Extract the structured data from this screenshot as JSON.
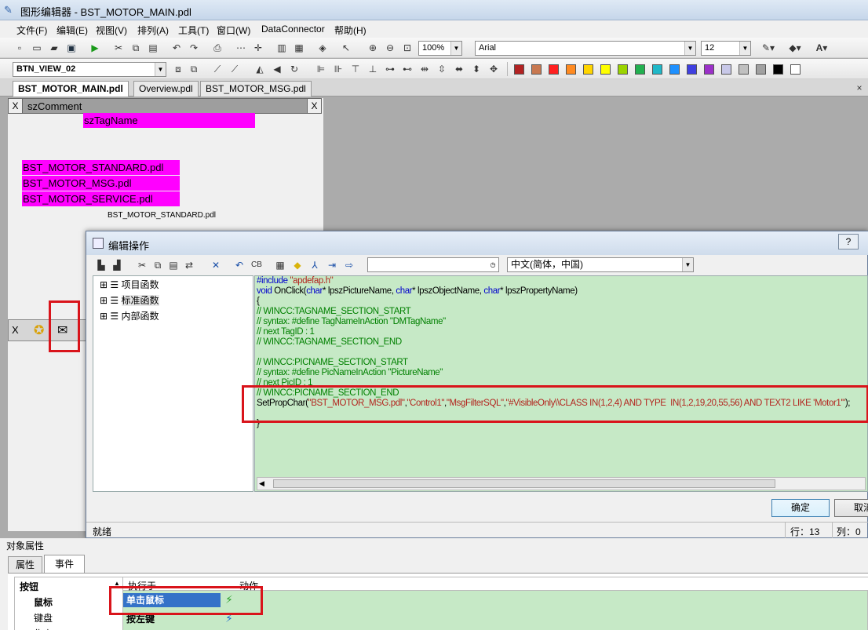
{
  "window": {
    "title": "图形编辑器 - BST_MOTOR_MAIN.pdl"
  },
  "menu": [
    "文件(F)",
    "编辑(E)",
    "视图(V)",
    "排列(A)",
    "工具(T)",
    "窗口(W)",
    "DataConnector",
    "帮助(H)"
  ],
  "toolbar1": {
    "zoom": "100%",
    "font": "Arial",
    "size": "12"
  },
  "toolbar2": {
    "object": "BTN_VIEW_02"
  },
  "palette": [
    "#b22222",
    "#c87850",
    "#ff2020",
    "#ff8a20",
    "#ffd500",
    "#ffff00",
    "#9bd400",
    "#22b050",
    "#20b8c8",
    "#1e90ff",
    "#4040e0",
    "#9b30c8",
    "#c8c8e8",
    "#c0c0c0",
    "#a0a0a0",
    "#000000",
    "#ffffff"
  ],
  "tabs": [
    "BST_MOTOR_MAIN.pdl",
    "Overview.pdl",
    "BST_MOTOR_MSG.pdl"
  ],
  "canvas": {
    "header": "szComment",
    "close": "X",
    "tagname": "szTagName",
    "links": [
      "BST_MOTOR_STANDARD.pdl",
      "BST_MOTOR_MSG.pdl",
      "BST_MOTOR_SERVICE.pdl"
    ],
    "caption": "BST_MOTOR_STANDARD.pdl"
  },
  "dialog": {
    "title": "编辑操作",
    "help": "?",
    "lang": "中文(简体，中国)",
    "tree": [
      "项目函数",
      "标准函数",
      "内部函数"
    ],
    "code": {
      "l1a": "#include ",
      "l1b": "\"apdefap.h\"",
      "l2a": "void",
      "l2b": " OnClick(",
      "l2c": "char",
      "l2d": "* lpszPictureName, ",
      "l2e": "char",
      "l2f": "* lpszObjectName, ",
      "l2g": "char",
      "l2h": "* lpszPropertyName)",
      "l3": "{",
      "l4": "// WINCC:TAGNAME_SECTION_START",
      "l5": "// syntax: #define TagNameInAction \"DMTagName\"",
      "l6": "// next TagID : 1",
      "l7": "// WINCC:TAGNAME_SECTION_END",
      "l8": "// WINCC:PICNAME_SECTION_START",
      "l9": "// syntax: #define PicNameInAction \"PictureName\"",
      "l10": "// next PicID : 1",
      "l11": "// WINCC:PICNAME_SECTION_END",
      "l12a": "SetPropChar(",
      "l12b": "\"BST_MOTOR_MSG.pdl\"",
      "l12c": ",",
      "l12d": "\"Control1\"",
      "l12e": ",",
      "l12f": "\"MsgFilterSQL\"",
      "l12g": ",",
      "l12h": "\"#VisibleOnly\\\\CLASS IN(1,2,4) AND TYPE  IN(1,2,19,20,55,56) AND TEXT2 LIKE 'Motor1'\"",
      "l12i": ");",
      "l13": "}"
    },
    "ok": "确定",
    "cancel": "取消",
    "status": "就绪",
    "row": "行：13",
    "col": "列：0"
  },
  "props": {
    "title": "对象属性",
    "tabs": [
      "属性",
      "事件"
    ],
    "tree": [
      "按钮",
      "鼠标",
      "键盘",
      "焦点"
    ],
    "col1": "执行于",
    "col2": "动作",
    "row1": "单击鼠标",
    "row2": "按左键"
  }
}
